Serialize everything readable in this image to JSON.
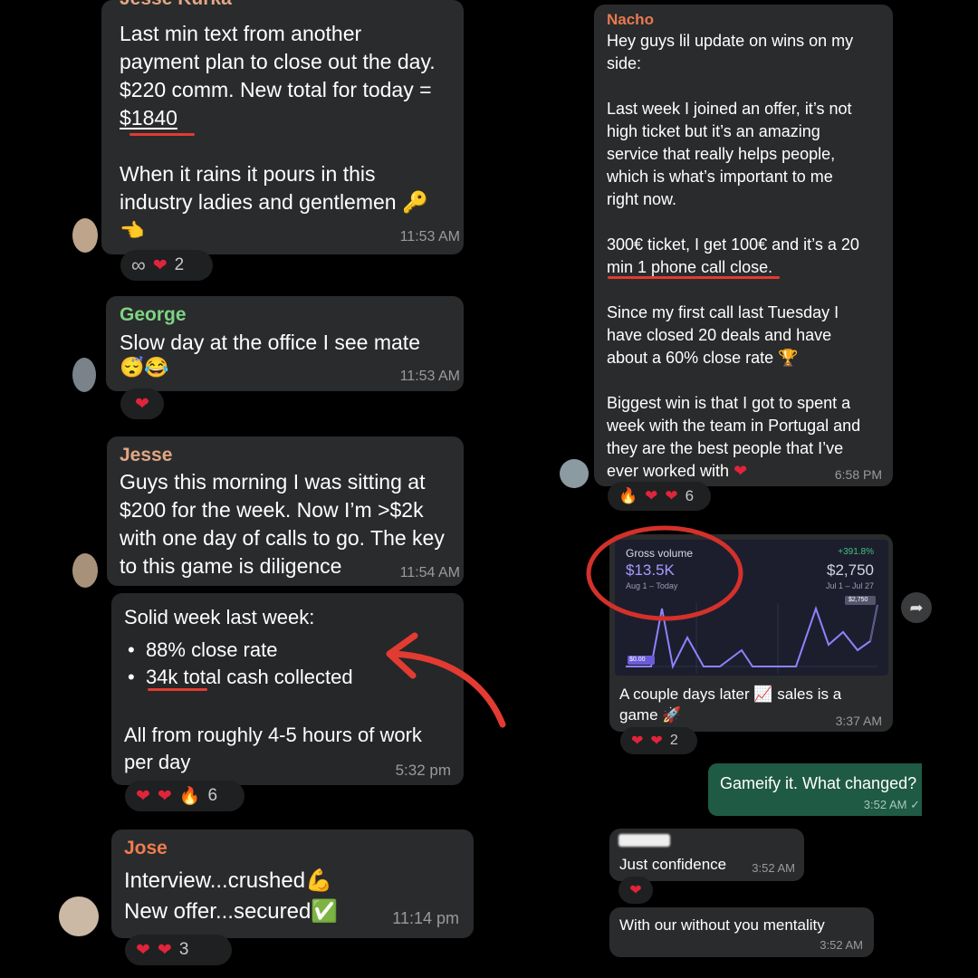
{
  "left": {
    "msg1": {
      "sender_cut": "Jesse Kurka",
      "lines": [
        "Last min text from another",
        "payment plan to close out the day.",
        "$220 comm. New total for today =",
        "$1840",
        "",
        "When it rains it pours in this",
        "industry ladies and gentlemen"
      ],
      "time": "11:53 AM",
      "reactions": {
        "icons": [
          "infinity-icon",
          "heart-icon"
        ],
        "count": "2"
      }
    },
    "msg2": {
      "sender": "George",
      "text": "Slow day at the office I see mate",
      "time": "11:53 AM",
      "reactions": {
        "icons": [
          "heart-icon"
        ]
      }
    },
    "msg3": {
      "sender": "Jesse",
      "lines": [
        "Guys this morning I was sitting at",
        "$200 for the week. Now I’m >$2k",
        "with one day of calls to go. The key",
        "to this game is diligence"
      ],
      "time": "11:54 AM"
    },
    "msg4": {
      "title": "Solid week last week:",
      "bullets": [
        "88% close rate",
        "34k total cash collected"
      ],
      "footer_lines": [
        "All from roughly 4-5 hours of work",
        "per day"
      ],
      "time": "5:32 pm",
      "reactions": {
        "count": "6"
      }
    },
    "msg5": {
      "sender": "Jose",
      "lines": [
        "Interview...crushed",
        "New offer...secured"
      ],
      "time": "11:14 pm",
      "reactions": {
        "count": "3"
      }
    }
  },
  "right": {
    "msg1": {
      "sender": "Nacho",
      "lines": [
        "Hey guys lil update on wins on my",
        "side:",
        "",
        "Last week I joined an offer, it’s not",
        "high ticket but it’s an amazing",
        "service that really helps people,",
        "which is what’s important to me",
        "right now.",
        "",
        "300€ ticket, I get 100€ and it’s a 20",
        "min 1 phone call close.",
        "",
        "Since my first call last Tuesday I",
        "have closed 20 deals and have",
        "about a 60% close rate",
        "",
        "Biggest win is that I got to spent a",
        "week with the team in Portugal and",
        "they are the best people that I’ve",
        "ever worked with"
      ],
      "time": "6:58 PM",
      "reactions": {
        "count": "6"
      }
    },
    "chart": {
      "label": "Gross volume",
      "value": "$13.5K",
      "range": "Aug 1 – Today",
      "change": "+391.8%",
      "prev_value": "$2,750",
      "prev_range": "Jul 1 – Jul 27",
      "start_label": "$0.00",
      "end_label": "$2,750"
    },
    "msg2": {
      "lines": [
        "A couple days later",
        "sales is a",
        "game"
      ],
      "time": "3:37 AM",
      "reactions": {
        "count": "2"
      }
    },
    "msg3": {
      "text": "Gameify it. What changed?",
      "time": "3:52 AM",
      "check": "✓"
    },
    "msg4": {
      "text": "Just confidence",
      "time": "3:52 AM"
    },
    "msg5": {
      "text": "With our without you mentality",
      "time": "3:52 AM"
    }
  },
  "colors": {
    "bubble": "#2a2b2c",
    "sent_bubble": "#1f5a45",
    "george": "#7ed384",
    "jesse": "#e2a684",
    "jose": "#ef7c50",
    "nacho": "#e8794f",
    "accent_red": "#e23b32",
    "chart_bg": "#1c1e2e",
    "chart_line": "#8f82ff"
  }
}
